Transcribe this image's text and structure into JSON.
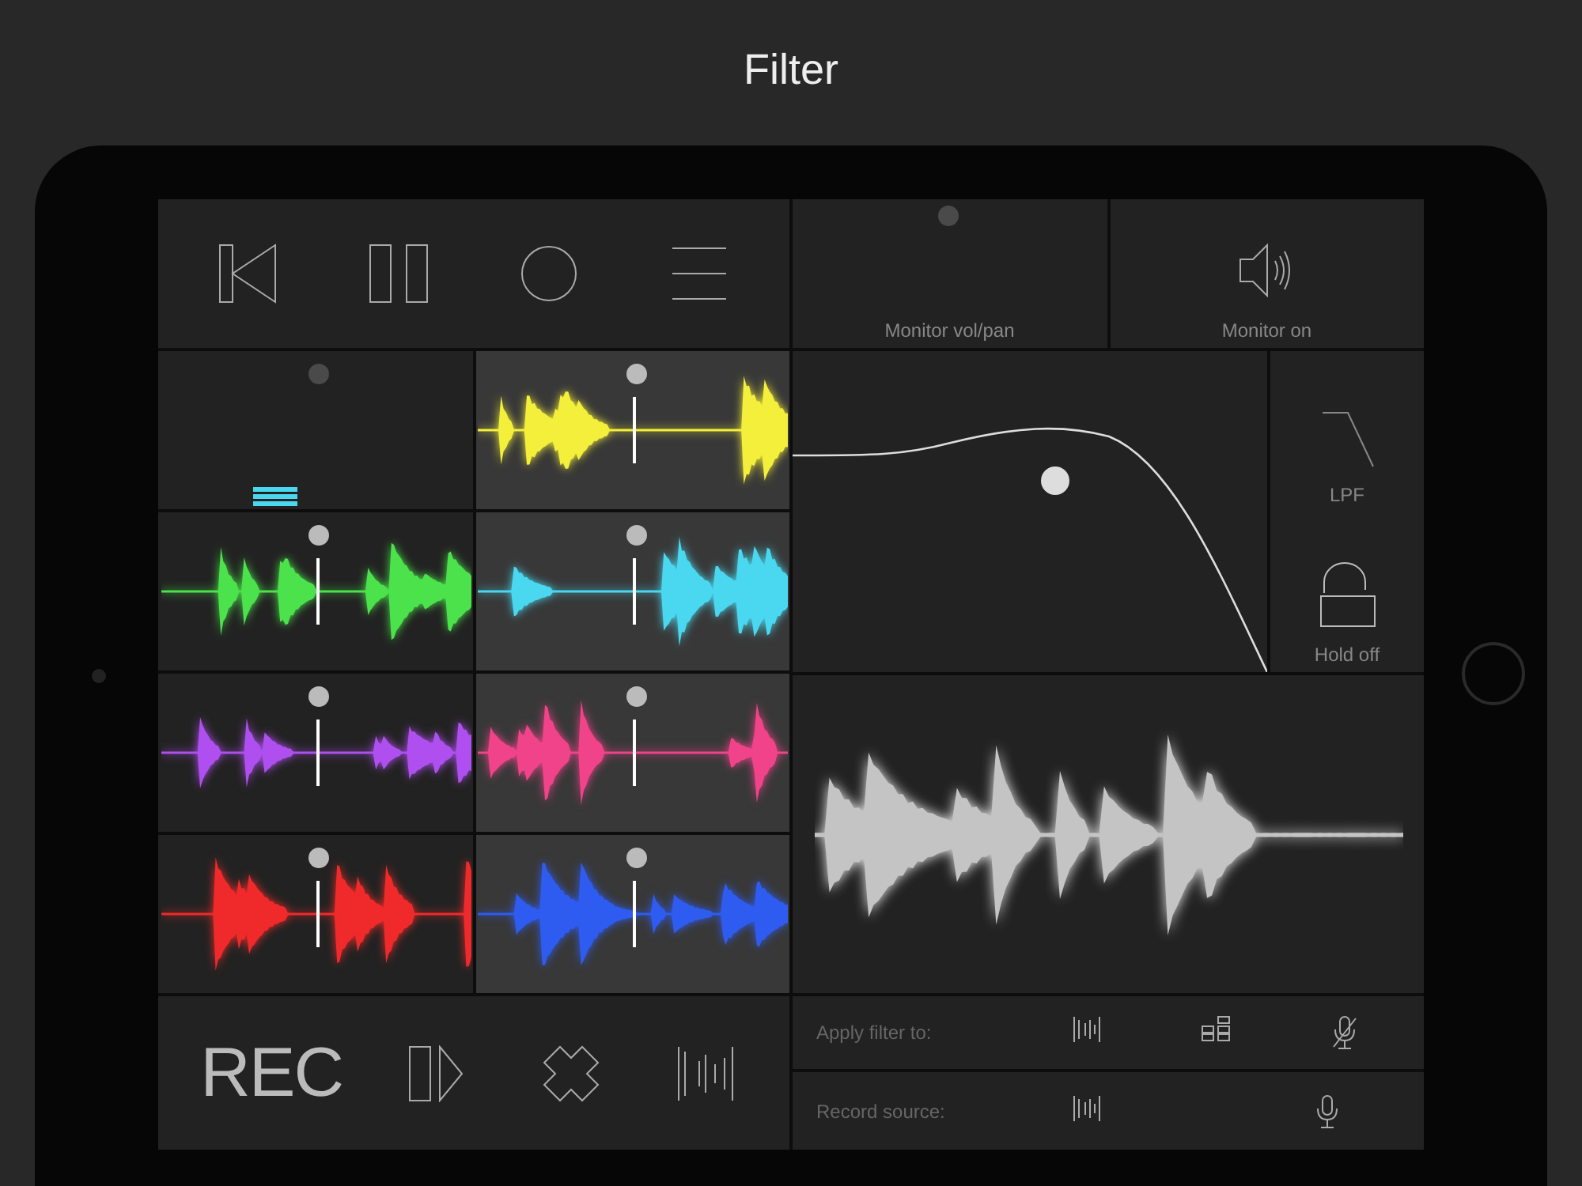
{
  "title": "Filter",
  "transport": [
    {
      "kind": "skip-back"
    },
    {
      "kind": "pause"
    },
    {
      "kind": "record"
    },
    {
      "kind": "menu"
    }
  ],
  "clips": [
    {
      "kind": "empty",
      "color": "#4ad8f0"
    },
    {
      "kind": "wave",
      "color": "#f4ef3a"
    },
    {
      "kind": "wave",
      "color": "#4be24b"
    },
    {
      "kind": "wave",
      "color": "#4ad8f0"
    },
    {
      "kind": "wave",
      "color": "#b04ff0"
    },
    {
      "kind": "wave",
      "color": "#f0438a"
    },
    {
      "kind": "wave",
      "color": "#f02a2a"
    },
    {
      "kind": "wave",
      "color": "#2f5cf0"
    }
  ],
  "bottom": [
    {
      "kind": "text",
      "label": "REC"
    },
    {
      "kind": "play-step"
    },
    {
      "kind": "clear"
    },
    {
      "kind": "wave-bars"
    }
  ],
  "monitor": {
    "volume_label": "Monitor vol/pan",
    "speaker_label": "Monitor on"
  },
  "filter": {
    "type_label": "LPF",
    "hold_label": "Hold off"
  },
  "apply_filter": {
    "label": "Apply filter to:",
    "options": [
      {
        "kind": "wave-bars"
      },
      {
        "kind": "grid"
      },
      {
        "kind": "mic-off"
      }
    ]
  },
  "record_source": {
    "label": "Record source:",
    "options": [
      {
        "kind": "wave-bars"
      },
      {
        "kind": "mic"
      }
    ]
  }
}
